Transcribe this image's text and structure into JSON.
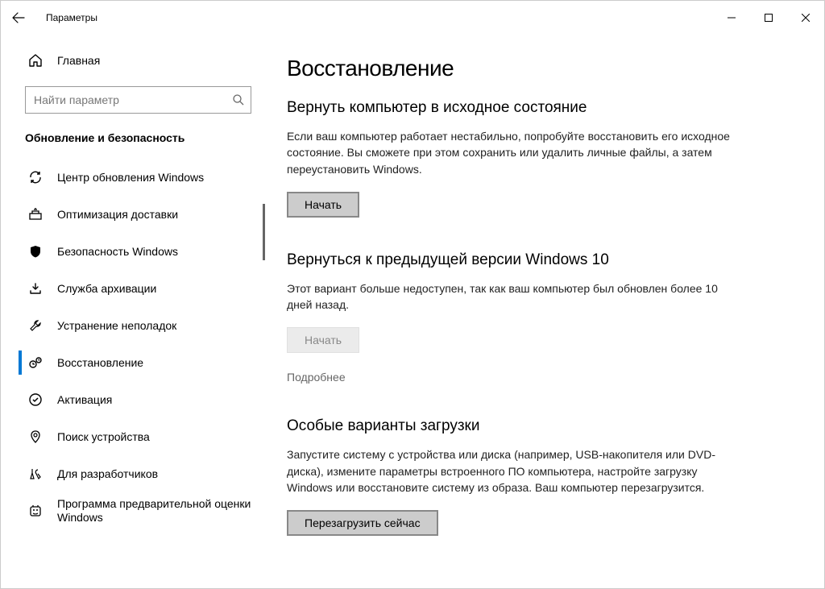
{
  "window": {
    "title": "Параметры"
  },
  "sidebar": {
    "home": "Главная",
    "search_placeholder": "Найти параметр",
    "category": "Обновление и безопасность",
    "items": [
      {
        "label": "Центр обновления Windows"
      },
      {
        "label": "Оптимизация доставки"
      },
      {
        "label": "Безопасность Windows"
      },
      {
        "label": "Служба архивации"
      },
      {
        "label": "Устранение неполадок"
      },
      {
        "label": "Восстановление"
      },
      {
        "label": "Активация"
      },
      {
        "label": "Поиск устройства"
      },
      {
        "label": "Для разработчиков"
      },
      {
        "label": "Программа предварительной оценки Windows"
      }
    ]
  },
  "main": {
    "title": "Восстановление",
    "sections": {
      "reset": {
        "heading": "Вернуть компьютер в исходное состояние",
        "desc": "Если ваш компьютер работает нестабильно, попробуйте восстановить его исходное состояние. Вы сможете при этом сохранить или удалить личные файлы, а затем переустановить Windows.",
        "button": "Начать"
      },
      "rollback": {
        "heading": "Вернуться к предыдущей версии Windows 10",
        "desc": "Этот вариант больше недоступен, так как ваш компьютер был обновлен более 10 дней назад.",
        "button": "Начать",
        "more": "Подробнее"
      },
      "advanced": {
        "heading": "Особые варианты загрузки",
        "desc": "Запустите систему с устройства или диска (например, USB-накопителя или DVD-диска), измените параметры встроенного ПО компьютера, настройте загрузку Windows или восстановите систему из образа. Ваш компьютер перезагрузится.",
        "button": "Перезагрузить сейчас"
      }
    }
  }
}
